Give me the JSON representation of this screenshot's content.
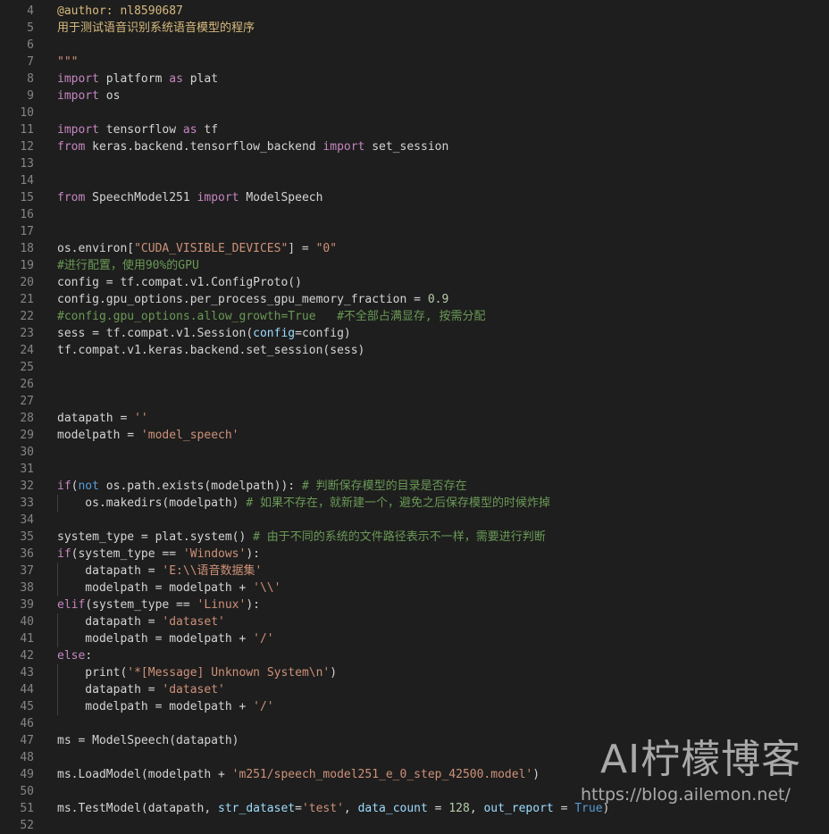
{
  "editor": {
    "colors": {
      "background": "#1e1e1e",
      "keyword": "#c586c0",
      "builtin": "#569cd6",
      "string": "#ce9178",
      "comment": "#6a9955",
      "variable": "#9cdcfe",
      "number": "#b5cea8",
      "plain": "#d4d4d4",
      "line_number": "#858585"
    },
    "lines": [
      {
        "n": "4",
        "indent": false,
        "tokens": [
          {
            "t": "@author: nl8590687",
            "c": "dec"
          }
        ]
      },
      {
        "n": "5",
        "indent": false,
        "tokens": [
          {
            "t": "用于测试语音识别系统语音模型的程序",
            "c": "dec"
          }
        ]
      },
      {
        "n": "6",
        "indent": false,
        "tokens": []
      },
      {
        "n": "7",
        "indent": false,
        "tokens": [
          {
            "t": "\"\"\"",
            "c": "str"
          }
        ]
      },
      {
        "n": "8",
        "indent": false,
        "tokens": [
          {
            "t": "import",
            "c": "kw"
          },
          {
            "t": " platform ",
            "c": "plain"
          },
          {
            "t": "as",
            "c": "kw"
          },
          {
            "t": " plat",
            "c": "plain"
          }
        ]
      },
      {
        "n": "9",
        "indent": false,
        "tokens": [
          {
            "t": "import",
            "c": "kw"
          },
          {
            "t": " os",
            "c": "plain"
          }
        ]
      },
      {
        "n": "10",
        "indent": false,
        "tokens": []
      },
      {
        "n": "11",
        "indent": false,
        "tokens": [
          {
            "t": "import",
            "c": "kw"
          },
          {
            "t": " tensorflow ",
            "c": "plain"
          },
          {
            "t": "as",
            "c": "kw"
          },
          {
            "t": " tf",
            "c": "plain"
          }
        ]
      },
      {
        "n": "12",
        "indent": false,
        "tokens": [
          {
            "t": "from",
            "c": "kw"
          },
          {
            "t": " keras.backend.tensorflow_backend ",
            "c": "plain"
          },
          {
            "t": "import",
            "c": "kw"
          },
          {
            "t": " set_session",
            "c": "plain"
          }
        ]
      },
      {
        "n": "13",
        "indent": false,
        "tokens": []
      },
      {
        "n": "14",
        "indent": false,
        "tokens": []
      },
      {
        "n": "15",
        "indent": false,
        "tokens": [
          {
            "t": "from",
            "c": "kw"
          },
          {
            "t": " SpeechModel251 ",
            "c": "plain"
          },
          {
            "t": "import",
            "c": "kw"
          },
          {
            "t": " ModelSpeech",
            "c": "plain"
          }
        ]
      },
      {
        "n": "16",
        "indent": false,
        "tokens": []
      },
      {
        "n": "17",
        "indent": false,
        "tokens": []
      },
      {
        "n": "18",
        "indent": false,
        "tokens": [
          {
            "t": "os.environ[",
            "c": "plain"
          },
          {
            "t": "\"CUDA_VISIBLE_DEVICES\"",
            "c": "str"
          },
          {
            "t": "] = ",
            "c": "plain"
          },
          {
            "t": "\"0\"",
            "c": "str"
          }
        ]
      },
      {
        "n": "19",
        "indent": false,
        "tokens": [
          {
            "t": "#进行配置，使用90%的GPU",
            "c": "com"
          }
        ]
      },
      {
        "n": "20",
        "indent": false,
        "tokens": [
          {
            "t": "config = tf.compat.v1.ConfigProto()",
            "c": "plain"
          }
        ]
      },
      {
        "n": "21",
        "indent": false,
        "tokens": [
          {
            "t": "config.gpu_options.per_process_gpu_memory_fraction = ",
            "c": "plain"
          },
          {
            "t": "0.9",
            "c": "num"
          }
        ]
      },
      {
        "n": "22",
        "indent": false,
        "tokens": [
          {
            "t": "#config.gpu_options.allow_growth=True   #不全部占满显存, 按需分配",
            "c": "com"
          }
        ]
      },
      {
        "n": "23",
        "indent": false,
        "tokens": [
          {
            "t": "sess = tf.compat.v1.Session(",
            "c": "plain"
          },
          {
            "t": "config",
            "c": "var"
          },
          {
            "t": "=config)",
            "c": "plain"
          }
        ]
      },
      {
        "n": "24",
        "indent": false,
        "tokens": [
          {
            "t": "tf.compat.v1.keras.backend.set_session(sess)",
            "c": "plain"
          }
        ]
      },
      {
        "n": "25",
        "indent": false,
        "tokens": []
      },
      {
        "n": "26",
        "indent": false,
        "tokens": []
      },
      {
        "n": "27",
        "indent": false,
        "tokens": []
      },
      {
        "n": "28",
        "indent": false,
        "tokens": [
          {
            "t": "datapath = ",
            "c": "plain"
          },
          {
            "t": "''",
            "c": "str"
          }
        ]
      },
      {
        "n": "29",
        "indent": false,
        "tokens": [
          {
            "t": "modelpath = ",
            "c": "plain"
          },
          {
            "t": "'model_speech'",
            "c": "str"
          }
        ]
      },
      {
        "n": "30",
        "indent": false,
        "tokens": []
      },
      {
        "n": "31",
        "indent": false,
        "tokens": []
      },
      {
        "n": "32",
        "indent": false,
        "tokens": [
          {
            "t": "if",
            "c": "kw"
          },
          {
            "t": "(",
            "c": "plain"
          },
          {
            "t": "not",
            "c": "bl"
          },
          {
            "t": " os.path.exists(modelpath)): ",
            "c": "plain"
          },
          {
            "t": "# 判断保存模型的目录是否存在",
            "c": "com"
          }
        ]
      },
      {
        "n": "33",
        "indent": true,
        "tokens": [
          {
            "t": "    os.makedirs(modelpath) ",
            "c": "plain"
          },
          {
            "t": "# 如果不存在，就新建一个，避免之后保存模型的时候炸掉",
            "c": "com"
          }
        ]
      },
      {
        "n": "34",
        "indent": false,
        "tokens": []
      },
      {
        "n": "35",
        "indent": false,
        "tokens": [
          {
            "t": "system_type = plat.system() ",
            "c": "plain"
          },
          {
            "t": "# 由于不同的系统的文件路径表示不一样，需要进行判断",
            "c": "com"
          }
        ]
      },
      {
        "n": "36",
        "indent": false,
        "tokens": [
          {
            "t": "if",
            "c": "kw"
          },
          {
            "t": "(system_type == ",
            "c": "plain"
          },
          {
            "t": "'Windows'",
            "c": "str"
          },
          {
            "t": "):",
            "c": "plain"
          }
        ]
      },
      {
        "n": "37",
        "indent": true,
        "tokens": [
          {
            "t": "    datapath = ",
            "c": "plain"
          },
          {
            "t": "'E:\\\\语音数据集'",
            "c": "str"
          }
        ]
      },
      {
        "n": "38",
        "indent": true,
        "tokens": [
          {
            "t": "    modelpath = modelpath + ",
            "c": "plain"
          },
          {
            "t": "'\\\\'",
            "c": "str"
          }
        ]
      },
      {
        "n": "39",
        "indent": false,
        "tokens": [
          {
            "t": "elif",
            "c": "kw"
          },
          {
            "t": "(system_type == ",
            "c": "plain"
          },
          {
            "t": "'Linux'",
            "c": "str"
          },
          {
            "t": "):",
            "c": "plain"
          }
        ]
      },
      {
        "n": "40",
        "indent": true,
        "tokens": [
          {
            "t": "    datapath = ",
            "c": "plain"
          },
          {
            "t": "'dataset'",
            "c": "str"
          }
        ]
      },
      {
        "n": "41",
        "indent": true,
        "tokens": [
          {
            "t": "    modelpath = modelpath + ",
            "c": "plain"
          },
          {
            "t": "'/'",
            "c": "str"
          }
        ]
      },
      {
        "n": "42",
        "indent": false,
        "tokens": [
          {
            "t": "else",
            "c": "kw"
          },
          {
            "t": ":",
            "c": "plain"
          }
        ]
      },
      {
        "n": "43",
        "indent": true,
        "tokens": [
          {
            "t": "    print(",
            "c": "plain"
          },
          {
            "t": "'*[Message] Unknown System\\n'",
            "c": "str"
          },
          {
            "t": ")",
            "c": "plain"
          }
        ]
      },
      {
        "n": "44",
        "indent": true,
        "tokens": [
          {
            "t": "    datapath = ",
            "c": "plain"
          },
          {
            "t": "'dataset'",
            "c": "str"
          }
        ]
      },
      {
        "n": "45",
        "indent": true,
        "tokens": [
          {
            "t": "    modelpath = modelpath + ",
            "c": "plain"
          },
          {
            "t": "'/'",
            "c": "str"
          }
        ]
      },
      {
        "n": "46",
        "indent": false,
        "tokens": []
      },
      {
        "n": "47",
        "indent": false,
        "tokens": [
          {
            "t": "ms = ModelSpeech(datapath)",
            "c": "plain"
          }
        ]
      },
      {
        "n": "48",
        "indent": false,
        "tokens": []
      },
      {
        "n": "49",
        "indent": false,
        "tokens": [
          {
            "t": "ms.LoadModel(modelpath + ",
            "c": "plain"
          },
          {
            "t": "'m251/speech_model251_e_0_step_42500.model'",
            "c": "str"
          },
          {
            "t": ")",
            "c": "plain"
          }
        ]
      },
      {
        "n": "50",
        "indent": false,
        "tokens": []
      },
      {
        "n": "51",
        "indent": false,
        "tokens": [
          {
            "t": "ms.TestModel(datapath, ",
            "c": "plain"
          },
          {
            "t": "str_dataset",
            "c": "var"
          },
          {
            "t": "=",
            "c": "plain"
          },
          {
            "t": "'test'",
            "c": "str"
          },
          {
            "t": ", ",
            "c": "plain"
          },
          {
            "t": "data_count",
            "c": "var"
          },
          {
            "t": " = ",
            "c": "plain"
          },
          {
            "t": "128",
            "c": "num"
          },
          {
            "t": ", ",
            "c": "plain"
          },
          {
            "t": "out_report",
            "c": "var"
          },
          {
            "t": " = ",
            "c": "plain"
          },
          {
            "t": "True",
            "c": "bl"
          },
          {
            "t": ")",
            "c": "plain"
          }
        ]
      },
      {
        "n": "52",
        "indent": false,
        "tokens": []
      }
    ]
  },
  "watermark": {
    "title": "AI柠檬博客",
    "url": "https://blog.ailemon.net/"
  }
}
